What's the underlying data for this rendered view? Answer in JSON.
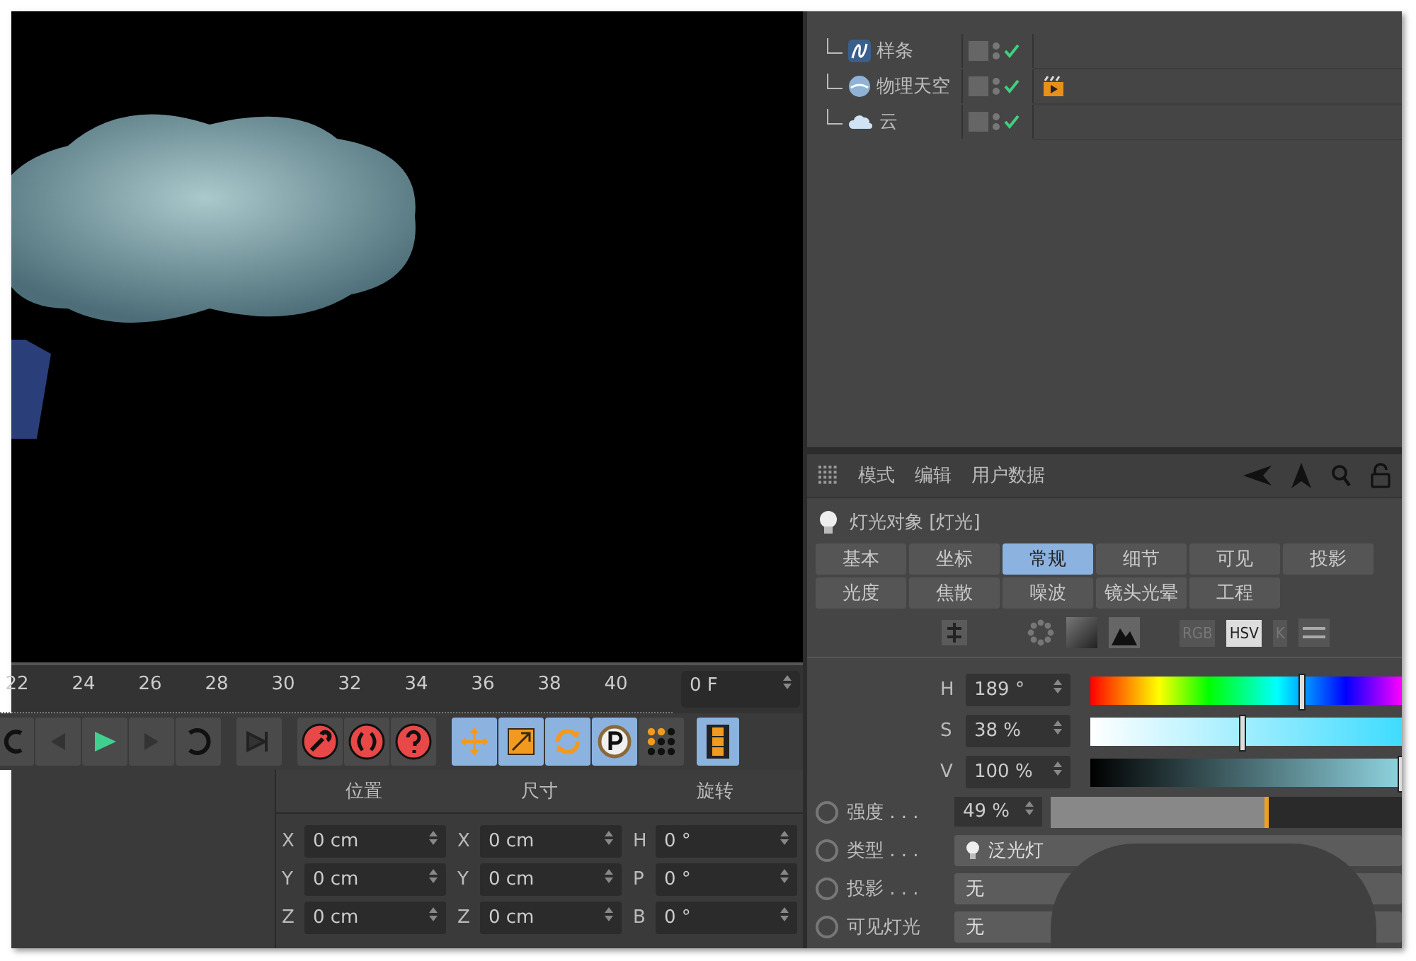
{
  "objects": [
    {
      "name": "样条",
      "kind": "spline",
      "enabled": true
    },
    {
      "name": "物理天空",
      "kind": "sky",
      "enabled": true,
      "tags": [
        {
          "kind": "render"
        }
      ]
    },
    {
      "name": "云",
      "kind": "cloud",
      "enabled": true
    }
  ],
  "attributes": {
    "menu": [
      "模式",
      "编辑",
      "用户数据"
    ],
    "title": "灯光对象 [灯光]",
    "tabs": [
      {
        "label": "基本",
        "selected": false
      },
      {
        "label": "坐标",
        "selected": false
      },
      {
        "label": "常规",
        "selected": true
      },
      {
        "label": "细节",
        "selected": false
      },
      {
        "label": "可见",
        "selected": false
      },
      {
        "label": "投影",
        "selected": false
      },
      {
        "label": "光度",
        "selected": false
      },
      {
        "label": "焦散",
        "selected": false
      },
      {
        "label": "噪波",
        "selected": false
      },
      {
        "label": "镜头光晕",
        "selected": false
      },
      {
        "label": "工程",
        "selected": false
      }
    ],
    "color_modes": [
      {
        "label": "RGB",
        "selected": false
      },
      {
        "label": "HSV",
        "selected": true
      },
      {
        "label": "K",
        "selected": false
      }
    ],
    "hsv": [
      {
        "label": "H",
        "value": "189 °",
        "kind": "hue",
        "level": 0.68
      },
      {
        "label": "S",
        "value": "38 %",
        "kind": "saturation",
        "level": 0.49
      },
      {
        "label": "V",
        "value": "100 %",
        "kind": "value",
        "level": 1
      }
    ],
    "params": [
      {
        "label": "强度 . . .",
        "kind": "slider",
        "value": "49 %",
        "level": 0.62,
        "animated": false
      },
      {
        "label": "类型 . . .",
        "kind": "dropdown",
        "value": "泛光灯",
        "icon": true,
        "animated": false
      },
      {
        "label": "投影 . . .",
        "kind": "dropdown",
        "value": "无",
        "animated": false
      },
      {
        "label": "可见灯光",
        "kind": "dropdown",
        "value": "无",
        "animated": false
      }
    ]
  },
  "timeline": {
    "ticks": [
      "22",
      "24",
      "26",
      "28",
      "30",
      "32",
      "34",
      "36",
      "38",
      "40"
    ],
    "frame": "0 F"
  },
  "tools": [
    {
      "kind": "move",
      "selected": true
    },
    {
      "kind": "scale",
      "selected": true
    },
    {
      "kind": "rotate",
      "selected": true
    },
    {
      "kind": "point",
      "selected": true
    },
    {
      "kind": "dots",
      "selected": false
    },
    {
      "kind": "film",
      "selected": true
    }
  ],
  "coordinates": {
    "columns": [
      {
        "header": "位置",
        "rows": [
          {
            "axis": "X",
            "value": "0 cm"
          },
          {
            "axis": "Y",
            "value": "0 cm"
          },
          {
            "axis": "Z",
            "value": "0 cm"
          }
        ]
      },
      {
        "header": "尺寸",
        "rows": [
          {
            "axis": "X",
            "value": "0 cm"
          },
          {
            "axis": "Y",
            "value": "0 cm"
          },
          {
            "axis": "Z",
            "value": "0 cm"
          }
        ]
      },
      {
        "header": "旋转",
        "rows": [
          {
            "axis": "H",
            "value": "0 °"
          },
          {
            "axis": "P",
            "value": "0 °"
          },
          {
            "axis": "B",
            "value": "0 °"
          }
        ]
      }
    ]
  }
}
